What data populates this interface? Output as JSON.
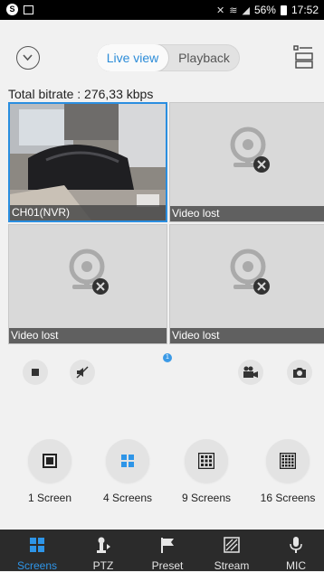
{
  "status_bar": {
    "battery": "56%",
    "time": "17:52"
  },
  "header": {
    "tabs": [
      {
        "label": "Live view",
        "active": true
      },
      {
        "label": "Playback",
        "active": false
      }
    ]
  },
  "bitrate": "Total bitrate : 276,33 kbps",
  "channels": [
    {
      "label": "CH01(NVR)",
      "state": "live"
    },
    {
      "label": "Video lost",
      "state": "lost"
    },
    {
      "label": "Video lost",
      "state": "lost"
    },
    {
      "label": "Video lost",
      "state": "lost"
    }
  ],
  "page_indicator": "1",
  "controls": [
    "stop-icon",
    "mute-icon",
    "record-icon",
    "snapshot-icon"
  ],
  "screen_modes": [
    {
      "label": "1 Screen",
      "active": false
    },
    {
      "label": "4 Screens",
      "active": true
    },
    {
      "label": "9 Screens",
      "active": false
    },
    {
      "label": "16 Screens",
      "active": false
    }
  ],
  "bottom_tabs": [
    {
      "label": "Screens",
      "active": true
    },
    {
      "label": "PTZ",
      "active": false
    },
    {
      "label": "Preset",
      "active": false
    },
    {
      "label": "Stream",
      "active": false
    },
    {
      "label": "MIC",
      "active": false
    }
  ],
  "colors": {
    "accent": "#2e95e8",
    "tabbar": "#2b2b2b",
    "selected_border": "#2a8ee0"
  }
}
